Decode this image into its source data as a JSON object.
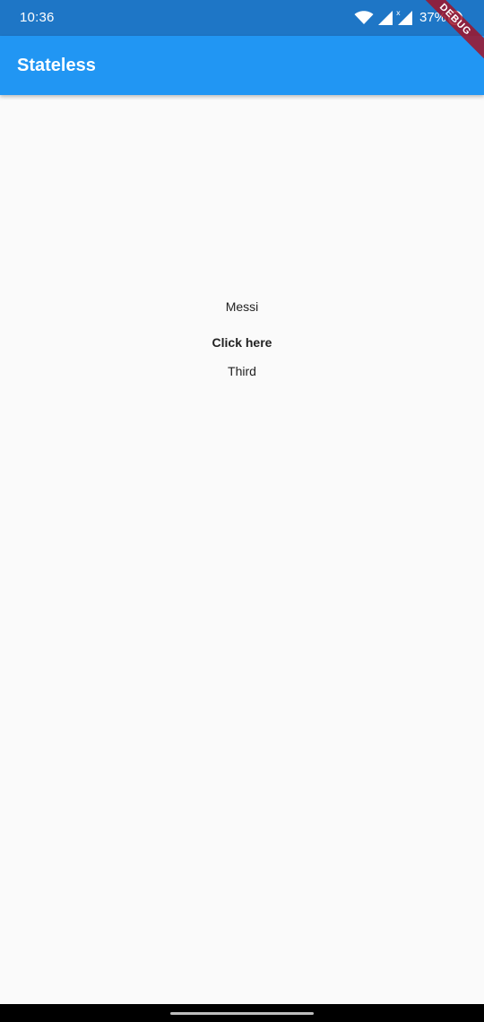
{
  "status_bar": {
    "time": "10:36",
    "battery": "37%",
    "icons": [
      "wifi-icon",
      "signal-icon",
      "signal-no-data-icon",
      "sync-icon"
    ]
  },
  "app_bar": {
    "title": "Stateless",
    "color": "#2196f3"
  },
  "debug_banner": {
    "label": "DEBUG"
  },
  "body": {
    "first_text": "Messi",
    "button_label": "Click here",
    "third_text": "Third"
  }
}
